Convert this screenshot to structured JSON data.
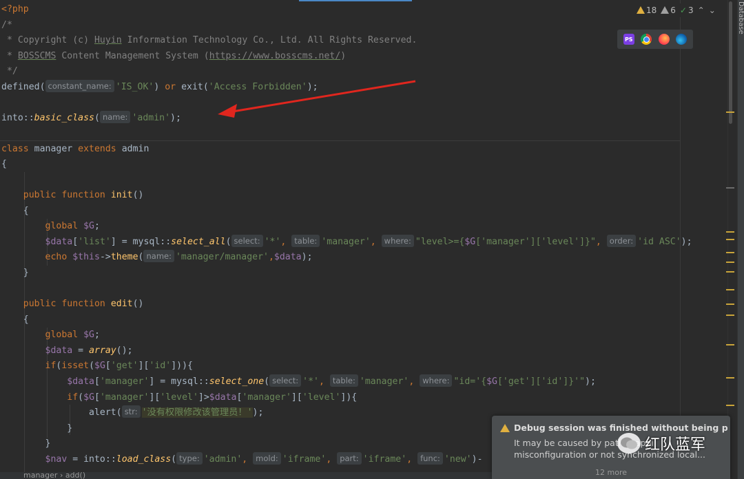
{
  "inspections": {
    "warnings": "18",
    "weak_warnings": "6",
    "ok": "3"
  },
  "sidebar": {
    "label": "Database"
  },
  "code": {
    "l1": "<?php",
    "l2": "/*",
    "l3_pre": " * Copyright (c) ",
    "l3_link": "Huyin",
    "l3_post": " Information Technology Co., Ltd. All Rights Reserved.",
    "l4_pre": " * ",
    "l4_name": "BOSSCMS",
    "l4_mid": " Content Management System (",
    "l4_url": "https://www.bosscms.net/",
    "l4_post": ")",
    "l5": " */",
    "l6_fn": "defined(",
    "l6_hint": "constant_name:",
    "l6_str": "'IS_OK'",
    "l6_or": " or ",
    "l6_exit": "exit(",
    "l6_msg": "'Access Forbidden'",
    "l6_end": ");",
    "l8_cls": "into::",
    "l8_fn": "basic_class",
    "l8_open": "(",
    "l8_hint": "name:",
    "l8_str": "'admin'",
    "l8_end": ");",
    "l10_kw1": "class",
    "l10_name": " manager ",
    "l10_kw2": "extends",
    "l10_parent": " admin",
    "l11": "{",
    "l13_kw": "public function ",
    "l13_fn": "init",
    "l13_end": "()",
    "l14": "{",
    "l15_kw": "global ",
    "l15_var": "$G",
    "l15_end": ";",
    "l16_var": "$data",
    "l16_a": "[",
    "l16_key": "'list'",
    "l16_b": "] = mysql::",
    "l16_fn": "select_all",
    "l16_c": "(",
    "l16_h1": "select:",
    "l16_s1": "'*'",
    "l16_h2": "table:",
    "l16_s2": "'manager'",
    "l16_h3": "where:",
    "l16_s3a": "\"level>={",
    "l16_s3var": "$G",
    "l16_s3b": "['manager']['level']}\"",
    "l16_h4": "order:",
    "l16_s4": "'id ASC'",
    "l16_end": ");",
    "l17_kw": "echo ",
    "l17_var": "$this",
    "l17_arrow": "->",
    "l17_fn": "theme",
    "l17_open": "(",
    "l17_hint": "name:",
    "l17_str": "'manager/manager'",
    "l17_comma": ",",
    "l17_var2": "$data",
    "l17_end": ");",
    "l18": "}",
    "l20_kw": "public function ",
    "l20_fn": "edit",
    "l20_end": "()",
    "l21": "{",
    "l22_kw": "global ",
    "l22_var": "$G",
    "l22_end": ";",
    "l23_var": "$data",
    "l23_mid": " = ",
    "l23_fn": "array",
    "l23_end": "();",
    "l24_kw": "if",
    "l24_a": "(",
    "l24_fn": "isset",
    "l24_b": "(",
    "l24_var": "$G",
    "l24_c": "[",
    "l24_k1": "'get'",
    "l24_d": "][",
    "l24_k2": "'id'",
    "l24_end": "])){",
    "l25_var": "$data",
    "l25_a": "[",
    "l25_key": "'manager'",
    "l25_b": "] = mysql::",
    "l25_fn": "select_one",
    "l25_c": "(",
    "l25_h1": "select:",
    "l25_s1": "'*'",
    "l25_h2": "table:",
    "l25_s2": "'manager'",
    "l25_h3": "where:",
    "l25_s3a": "\"id='{",
    "l25_s3var": "$G",
    "l25_s3b": "['get']['id']}'\"",
    "l25_end": ");",
    "l26_kw": "if",
    "l26_a": "(",
    "l26_var": "$G",
    "l26_b": "[",
    "l26_k1": "'manager'",
    "l26_c": "][",
    "l26_k2": "'level'",
    "l26_d": "]>",
    "l26_var2": "$data",
    "l26_e": "[",
    "l26_k3": "'manager'",
    "l26_f": "][",
    "l26_k4": "'level'",
    "l26_end": "]){",
    "l27_fn": "alert(",
    "l27_hint": "str:",
    "l27_str": "'没有权限修改该管理员！'",
    "l27_end": ");",
    "l28": "}",
    "l29": "}",
    "l30_var": "$nav",
    "l30_a": " = into::",
    "l30_fn": "load_class",
    "l30_b": "(",
    "l30_h1": "type:",
    "l30_s1": "'admin'",
    "l30_h2": "mold:",
    "l30_s2": "'iframe'",
    "l30_h3": "part:",
    "l30_s3": "'iframe'",
    "l30_h4": "func:",
    "l30_s4": "'new'",
    "l30_end": ")-",
    "comma": ", "
  },
  "breadcrumb": {
    "text": "manager  ›  add()"
  },
  "browsers": [
    "PhpStorm",
    "Chrome",
    "Firefox",
    "Edge"
  ],
  "notification": {
    "title": "Debug session was finished without being pau",
    "line1": "It may be caused by path mappi",
    "line2": "misconfiguration or not synchronized local...",
    "more": "12 more"
  },
  "watermark": {
    "text": "红队蓝军"
  },
  "colors": {
    "keyword": "#cc7832",
    "string": "#6a8759",
    "variable": "#9876aa",
    "function": "#ffc66d",
    "comment": "#808080",
    "arrow": "#e0261e"
  }
}
